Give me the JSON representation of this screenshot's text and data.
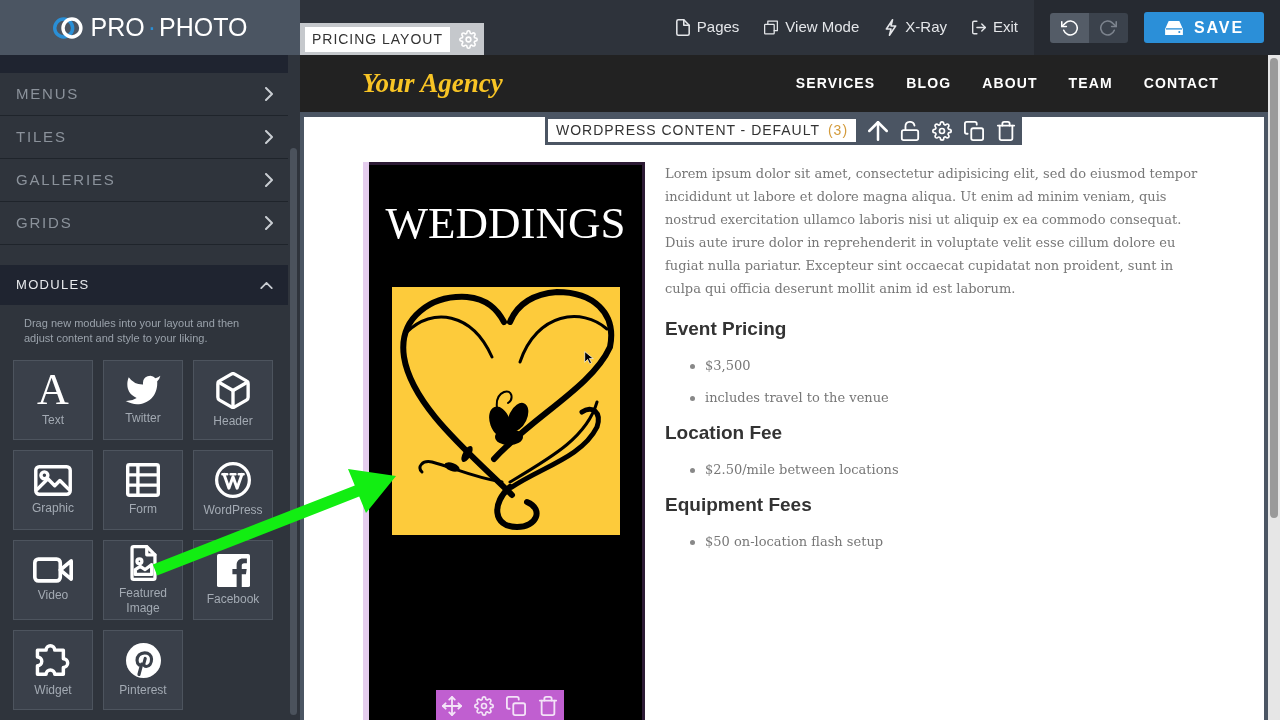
{
  "app": {
    "logo": {
      "parts": [
        "PRO",
        "·",
        "PHOTO"
      ]
    },
    "layout_badge": {
      "label": "PRICING LAYOUT"
    }
  },
  "toolbar": {
    "items": [
      {
        "label": "Pages"
      },
      {
        "label": "View Mode"
      },
      {
        "label": "X-Ray"
      },
      {
        "label": "Exit"
      }
    ],
    "undo": {
      "disabled": false
    },
    "redo": {
      "disabled": true
    },
    "save": {
      "label": "SAVE"
    }
  },
  "sidebar": {
    "library_items": [
      {
        "label": "MENUS"
      },
      {
        "label": "TILES"
      },
      {
        "label": "GALLERIES"
      },
      {
        "label": "GRIDS"
      }
    ],
    "modules": {
      "title": "MODULES",
      "expanded": true,
      "hint": "Drag new modules into your layout and then adjust content and style to your liking.",
      "tiles": [
        {
          "label": "Text",
          "glyph": "A"
        },
        {
          "label": "Twitter"
        },
        {
          "label": "Header"
        },
        {
          "label": "Graphic"
        },
        {
          "label": "Form"
        },
        {
          "label": "WordPress"
        },
        {
          "label": "Video"
        },
        {
          "label": "Featured Image"
        },
        {
          "label": "Facebook"
        },
        {
          "label": "Widget"
        },
        {
          "label": "Pinterest"
        }
      ]
    }
  },
  "preview": {
    "brand": "Your Agency",
    "nav": [
      {
        "label": "SERVICES"
      },
      {
        "label": "BLOG"
      },
      {
        "label": "ABOUT"
      },
      {
        "label": "TEAM"
      },
      {
        "label": "CONTACT"
      }
    ],
    "content_badge": {
      "label": "WORDPRESS CONTENT - DEFAULT",
      "count": "(3)"
    },
    "featured_image": {
      "title": "WEDDINGS"
    },
    "body": {
      "paragraph": "Lorem ipsum dolor sit amet, consectetur adipisicing elit, sed do eiusmod tempor incididunt ut labore et dolore magna aliqua. Ut enim ad minim veniam, quis nostrud exercitation ullamco laboris nisi ut aliquip ex ea commodo consequat. Duis aute irure dolor in reprehenderit in voluptate velit esse cillum dolore eu fugiat nulla pariatur. Excepteur sint occaecat cupidatat non proident, sunt in culpa qui officia deserunt mollit anim id est laborum.",
      "sections": [
        {
          "heading": "Event Pricing",
          "items": [
            "$3,500",
            "includes travel to the venue"
          ]
        },
        {
          "heading": "Location Fee",
          "items": [
            "$2.50/mile between locations"
          ]
        },
        {
          "heading": "Equipment Fees",
          "items": [
            "$50 on-location flash setup"
          ]
        }
      ]
    }
  }
}
